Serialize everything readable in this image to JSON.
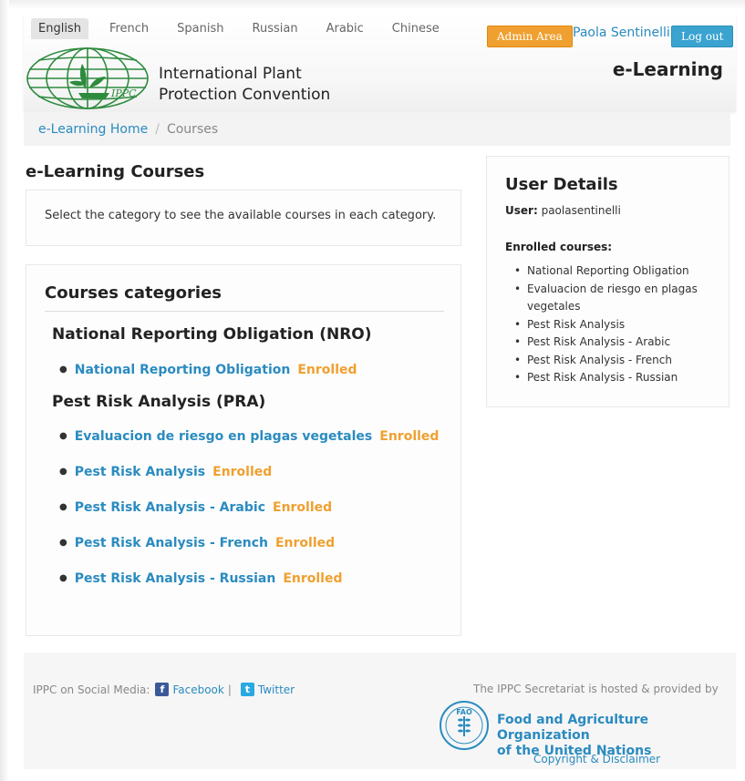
{
  "header": {
    "languages": [
      {
        "label": "English",
        "active": true
      },
      {
        "label": "French"
      },
      {
        "label": "Spanish"
      },
      {
        "label": "Russian"
      },
      {
        "label": "Arabic"
      },
      {
        "label": "Chinese"
      }
    ],
    "logo_text": "IPPC",
    "org_name_line1": "International Plant",
    "org_name_line2": "Protection Convention",
    "admin_label": "Admin Area",
    "user_name": "Paola Sentinelli",
    "logout_label": "Log out",
    "site_title": "e-Learning"
  },
  "breadcrumb": {
    "home": "e-Learning Home",
    "separator": "/",
    "current": "Courses"
  },
  "main": {
    "title": "e-Learning Courses",
    "intro": "Select the category to see the available courses in each category.",
    "categories_heading": "Courses categories",
    "groups": [
      {
        "title": "National Reporting Obligation (NRO)",
        "courses": [
          {
            "name": "National Reporting Obligation",
            "status": "Enrolled"
          }
        ]
      },
      {
        "title": "Pest Risk Analysis (PRA)",
        "courses": [
          {
            "name": "Evaluacion de riesgo en plagas vegetales",
            "status": "Enrolled"
          },
          {
            "name": "Pest Risk Analysis",
            "status": "Enrolled"
          },
          {
            "name": "Pest Risk Analysis - Arabic",
            "status": "Enrolled"
          },
          {
            "name": "Pest Risk Analysis - French",
            "status": "Enrolled"
          },
          {
            "name": "Pest Risk Analysis - Russian",
            "status": "Enrolled"
          }
        ]
      }
    ]
  },
  "sidebar": {
    "title": "User Details",
    "user_label": "User:",
    "user_value": "paolasentinelli",
    "enrolled_label": "Enrolled courses:",
    "enrolled": [
      "National Reporting Obligation",
      "Evaluacion de riesgo en plagas vegetales",
      "Pest Risk Analysis",
      "Pest Risk Analysis - Arabic",
      "Pest Risk Analysis - French",
      "Pest Risk Analysis - Russian"
    ]
  },
  "footer": {
    "social_label": "IPPC on Social Media:",
    "facebook": "Facebook",
    "pipe": "|",
    "twitter": "Twitter",
    "hosted_text": "The IPPC Secretariat is hosted & provided by",
    "fao_logo_text": "FAO",
    "fao_name_line1": "Food and Agriculture Organization",
    "fao_name_line2": "of the United Nations",
    "copyright": "Copyright & Disclaimer"
  },
  "colors": {
    "link": "#2a8bc0",
    "enrolled": "#f0a030",
    "admin_button": "#f0a030",
    "logout_button": "#3aa3d0",
    "logo_green": "#2e8b3e"
  }
}
